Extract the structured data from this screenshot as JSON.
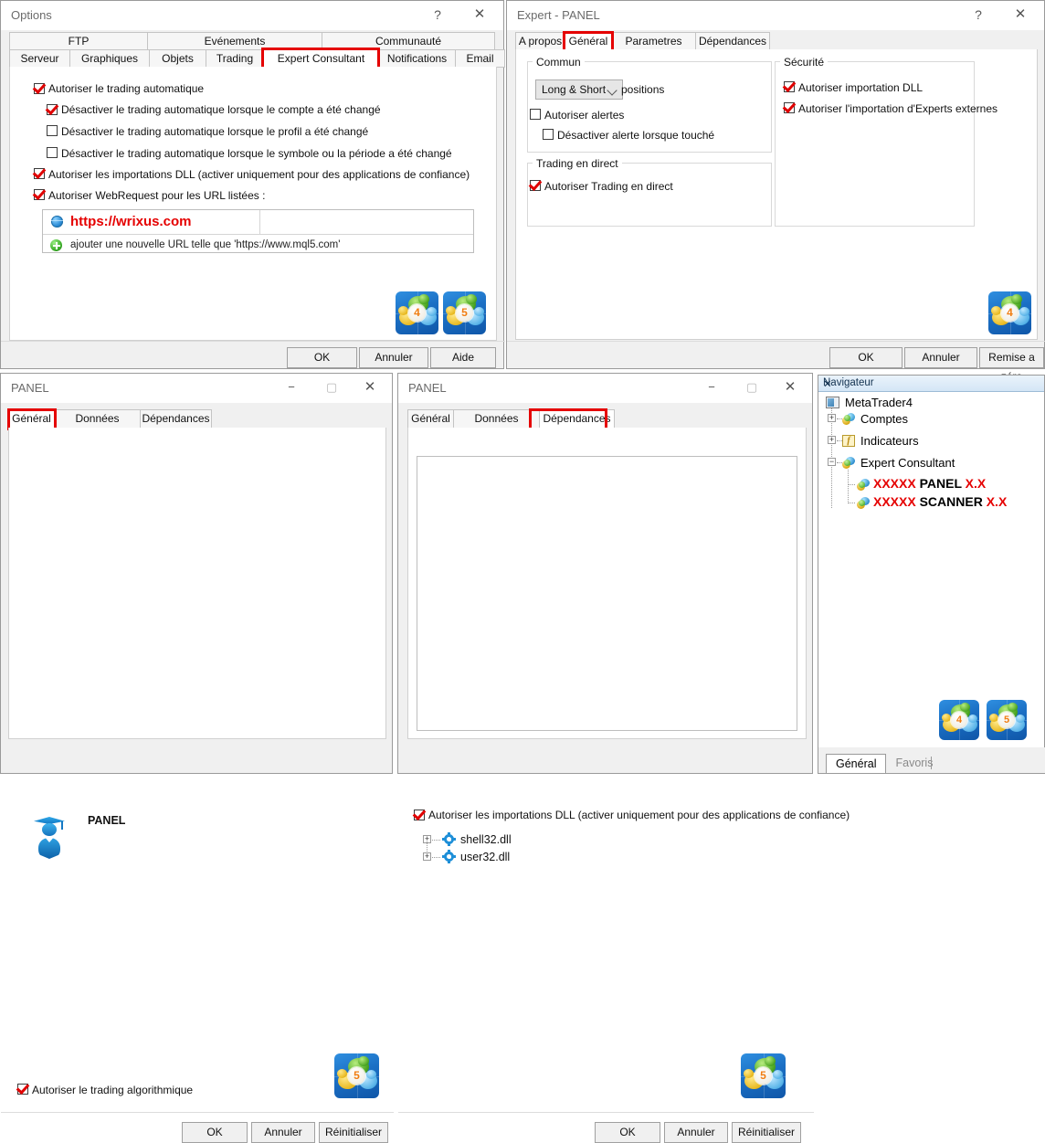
{
  "options_window": {
    "title": "Options",
    "titlebar_buttons": [
      "?",
      "✕"
    ],
    "tabs_row1": [
      "FTP",
      "Evénements",
      "Communauté"
    ],
    "tabs_row2": [
      "Serveur",
      "Graphiques",
      "Objets",
      "Trading",
      "Expert Consultant",
      "Notifications",
      "Email"
    ],
    "selected_tab": "Expert Consultant",
    "checkboxes": [
      {
        "label": "Autoriser le trading automatique",
        "checked": true,
        "indent": 0
      },
      {
        "label": "Désactiver le trading automatique lorsque le compte a été changé",
        "checked": true,
        "indent": 1
      },
      {
        "label": "Désactiver le trading automatique lorsque le profil a été changé",
        "checked": false,
        "indent": 1
      },
      {
        "label": "Désactiver le trading automatique lorsque le symbole ou la période a été changé",
        "checked": false,
        "indent": 1
      },
      {
        "label": "Autoriser les importations DLL (activer uniquement pour des applications de confiance)",
        "checked": true,
        "indent": 0
      },
      {
        "label": "Autoriser WebRequest pour les URL listées :",
        "checked": true,
        "indent": 0
      }
    ],
    "url_list": {
      "entry": "https://wrixus.com",
      "add_hint": "ajouter une nouvelle URL telle que 'https://www.mql5.com'"
    },
    "logos": [
      {
        "number": "4"
      },
      {
        "number": "5"
      }
    ],
    "buttons": [
      "OK",
      "Annuler",
      "Aide"
    ]
  },
  "expert_window": {
    "title": "Expert - PANEL",
    "titlebar_buttons": [
      "?",
      "✕"
    ],
    "tabs": [
      "A propos",
      "Général",
      "Parametres d'entrée",
      "Dépendances"
    ],
    "selected_tab": "Général",
    "group_commun": {
      "title": "Commun",
      "combo_value": "Long & Short",
      "combo_suffix": "positions",
      "checkboxes": [
        {
          "label": "Autoriser alertes",
          "checked": false,
          "indent": 0
        },
        {
          "label": "Désactiver alerte lorsque touché",
          "checked": false,
          "indent": 1
        }
      ]
    },
    "group_trading": {
      "title": "Trading en direct",
      "checkboxes": [
        {
          "label": "Autoriser Trading en direct",
          "checked": true
        }
      ]
    },
    "group_securite": {
      "title": "Sécurité",
      "checkboxes": [
        {
          "label": "Autoriser importation DLL",
          "checked": true
        },
        {
          "label": "Autoriser l'importation d'Experts externes",
          "checked": true
        }
      ]
    },
    "logos": [
      {
        "number": "4"
      }
    ],
    "buttons": [
      "OK",
      "Annuler",
      "Remise a zéro"
    ]
  },
  "panel_general_window": {
    "title": "PANEL",
    "titlebar_buttons": [
      "−",
      "▢",
      "✕"
    ],
    "tabs": [
      "Général",
      "Données d'entrée",
      "Dépendances"
    ],
    "selected_tab": "Général",
    "expert_name": "PANEL",
    "checkbox": {
      "label": "Autoriser le trading algorithmique",
      "checked": true
    },
    "logos": [
      {
        "number": "5"
      }
    ],
    "buttons": [
      "OK",
      "Annuler",
      "Réinitialiser"
    ]
  },
  "panel_deps_window": {
    "title": "PANEL",
    "titlebar_buttons": [
      "−",
      "▢",
      "✕"
    ],
    "tabs": [
      "Général",
      "Données d'entrée",
      "Dépendances"
    ],
    "selected_tab": "Dépendances",
    "checkbox": {
      "label": "Autoriser les importations DLL (activer uniquement pour des applications de confiance)",
      "checked": true
    },
    "dll_list": [
      "shell32.dll",
      "user32.dll"
    ],
    "logos": [
      {
        "number": "5"
      }
    ],
    "buttons": [
      "OK",
      "Annuler",
      "Réinitialiser"
    ]
  },
  "navigator_panel": {
    "title": "Navigateur",
    "close_glyph": "✕",
    "tree": [
      {
        "label": "MetaTrader4",
        "icon": "metatrader-icon",
        "level": 0,
        "expander": null
      },
      {
        "label": "Comptes",
        "icon": "accounts-icon",
        "level": 1,
        "expander": "+"
      },
      {
        "label": "Indicateurs",
        "icon": "indicator-icon",
        "level": 1,
        "expander": "+"
      },
      {
        "label": "Expert Consultant",
        "icon": "expert-icon",
        "level": 1,
        "expander": "−"
      },
      {
        "label_red_1": "XXXXX",
        "label_black": "PANEL",
        "label_red_2": "X.X",
        "icon": "expert-icon",
        "level": 2,
        "expander": null
      },
      {
        "label_red_1": "XXXXX",
        "label_black": "SCANNER",
        "label_red_2": "X.X",
        "icon": "expert-icon",
        "level": 2,
        "expander": null
      }
    ],
    "logos": [
      {
        "number": "4"
      },
      {
        "number": "5"
      }
    ],
    "tabs": [
      "Général",
      "Favoris"
    ],
    "selected_tab": "Général"
  },
  "colors": {
    "highlight_red": "#e50000",
    "window_bg": "#f0f0f0",
    "accent_blue": "#1e8fd8"
  }
}
